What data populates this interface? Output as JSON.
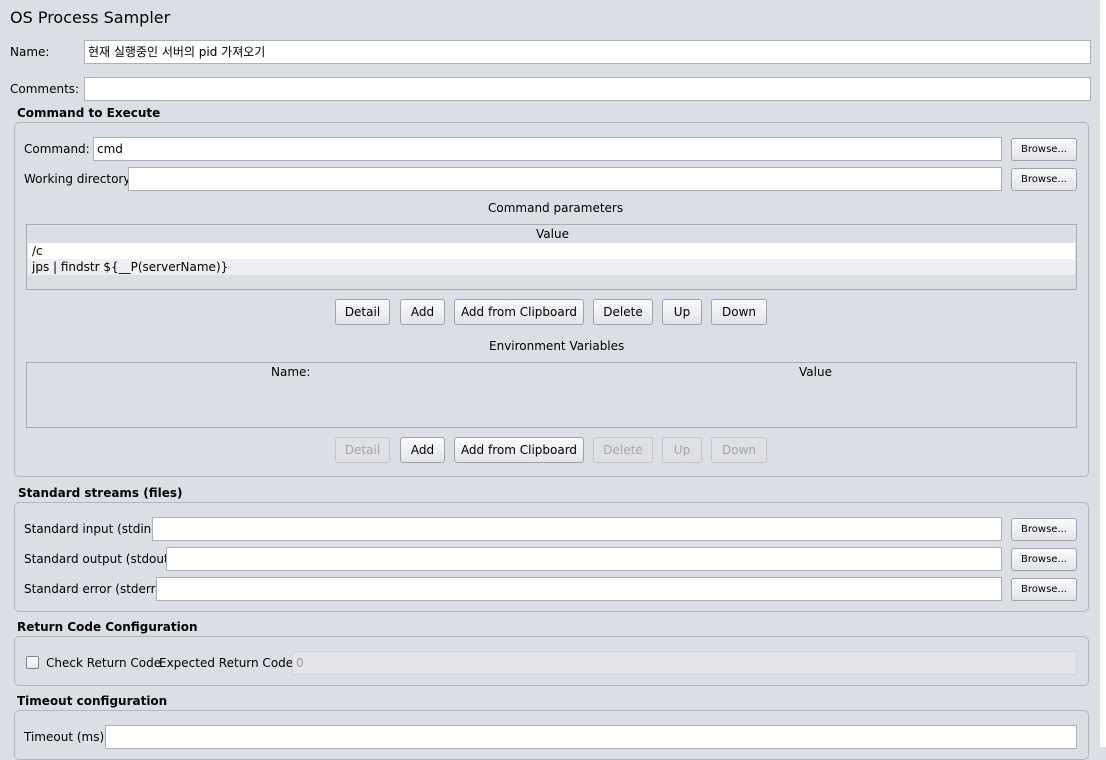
{
  "title": "OS Process Sampler",
  "name": {
    "label": "Name:",
    "value": "현재 실행중인 서버의 pid 가져오기"
  },
  "comments": {
    "label": "Comments:",
    "value": ""
  },
  "command_section": {
    "legend": "Command to Execute",
    "command_label": "Command:",
    "command_value": "cmd",
    "workdir_label": "Working directory:",
    "workdir_value": "",
    "browse": "Browse...",
    "params_title": "Command parameters",
    "params_header": "Value",
    "params_rows": [
      "/c",
      "jps | findstr ${__P(serverName)}"
    ],
    "params_buttons": [
      "Detail",
      "Add",
      "Add from Clipboard",
      "Delete",
      "Up",
      "Down"
    ],
    "env_title": "Environment Variables",
    "env_headers": [
      "Name:",
      "Value"
    ],
    "env_buttons": [
      "Detail",
      "Add",
      "Add from Clipboard",
      "Delete",
      "Up",
      "Down"
    ]
  },
  "streams": {
    "legend": "Standard streams (files)",
    "stdin_label": "Standard input (stdin):",
    "stdout_label": "Standard output (stdout):",
    "stderr_label": "Standard error (stderr):",
    "browse": "Browse..."
  },
  "return_code": {
    "legend": "Return Code Configuration",
    "check_label": "Check Return Code",
    "expected_label": "Expected Return Code:",
    "expected_value": "0",
    "checked": false
  },
  "timeout": {
    "legend": "Timeout configuration",
    "label": "Timeout (ms)",
    "value": ""
  }
}
